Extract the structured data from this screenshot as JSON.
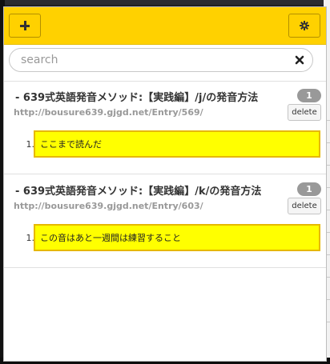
{
  "toolbar": {
    "add_icon": "plus-icon",
    "settings_icon": "gear-icon"
  },
  "search": {
    "placeholder": "search",
    "value": "",
    "clear_icon": "close-icon"
  },
  "entries": [
    {
      "title": "-  639式英語発音メソッド:【実践編】/j/の発音方法",
      "url": "http://bousure639.gjgd.net/Entry/569/",
      "count": "1",
      "delete_label": "delete",
      "notes": [
        {
          "index": "1.",
          "text": "ここまで読んだ"
        }
      ]
    },
    {
      "title": "-  639式英語発音メソッド:【実践編】/k/の発音方法",
      "url": "http://bousure639.gjgd.net/Entry/603/",
      "count": "1",
      "delete_label": "delete",
      "notes": [
        {
          "index": "1.",
          "text": "この音はあと一週間は練習すること"
        }
      ]
    }
  ],
  "colors": {
    "toolbar": "#ffd100",
    "note_highlight": "#ffff00",
    "note_border": "#e6b800",
    "badge": "#999999"
  }
}
